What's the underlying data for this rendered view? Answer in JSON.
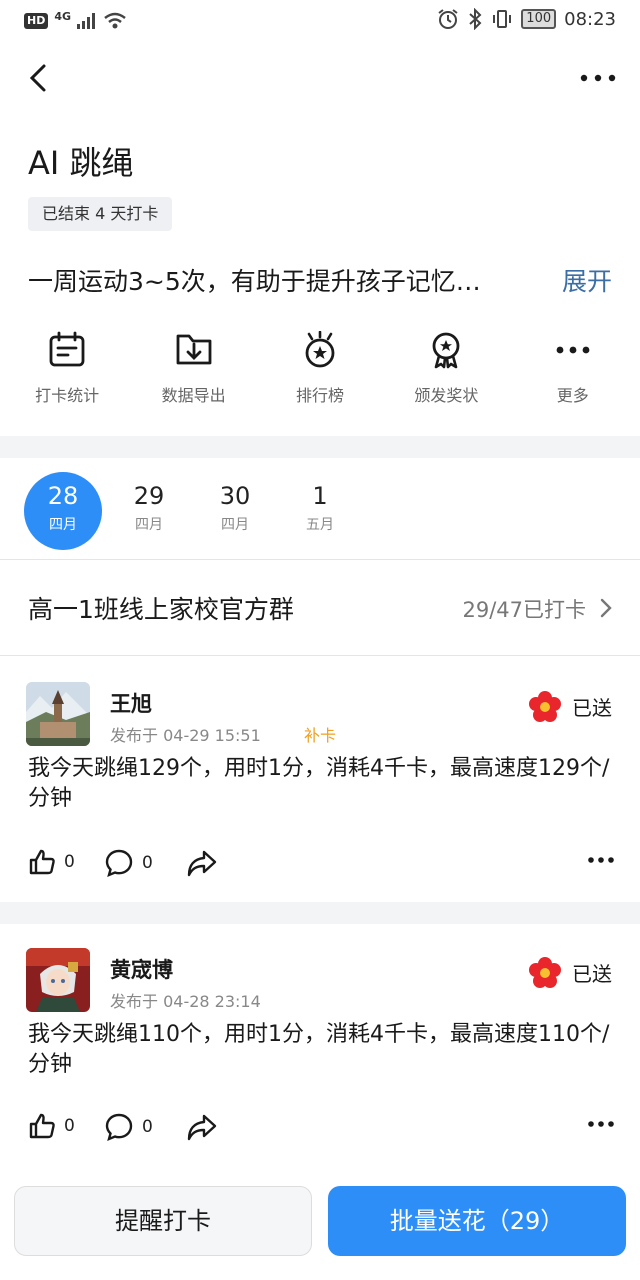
{
  "status_bar": {
    "time": "08:23",
    "battery": "100",
    "network": "4G",
    "hd": "HD"
  },
  "header": {
    "title": "AI 跳绳",
    "status_tag": "已结束 4 天打卡",
    "description": "一周运动3~5次，有助于提升孩子记忆…",
    "expand_label": "展开"
  },
  "actions": [
    {
      "icon": "checkin-stats-icon",
      "label": "打卡统计"
    },
    {
      "icon": "data-export-icon",
      "label": "数据导出"
    },
    {
      "icon": "leaderboard-icon",
      "label": "排行榜"
    },
    {
      "icon": "award-icon",
      "label": "颁发奖状"
    },
    {
      "icon": "more-icon",
      "label": "更多"
    }
  ],
  "dates": [
    {
      "day": "28",
      "month": "四月",
      "active": true
    },
    {
      "day": "29",
      "month": "四月",
      "active": false
    },
    {
      "day": "30",
      "month": "四月",
      "active": false
    },
    {
      "day": "1",
      "month": "五月",
      "active": false
    }
  ],
  "group": {
    "name": "高一1班线上家校官方群",
    "count": "29/47已打卡"
  },
  "posts": [
    {
      "name": "王旭",
      "time": "发布于 04-29 15:51",
      "makeup": "补卡",
      "sent": "已送",
      "text": "我今天跳绳129个，用时1分，消耗4千卡，最高速度129个/分钟",
      "likes": "0",
      "comments": "0"
    },
    {
      "name": "黄宬博",
      "time": "发布于 04-28 23:14",
      "makeup": "",
      "sent": "已送",
      "text": "我今天跳绳110个，用时1分，消耗4千卡，最高速度110个/分钟",
      "likes": "0",
      "comments": "0"
    }
  ],
  "bottom": {
    "remind_label": "提醒打卡",
    "batch_flower_label": "批量送花（29）"
  },
  "colors": {
    "accent": "#2e8ef7",
    "link": "#3a6ea5",
    "makeup": "#f0a020",
    "flower": "#e8262c"
  }
}
